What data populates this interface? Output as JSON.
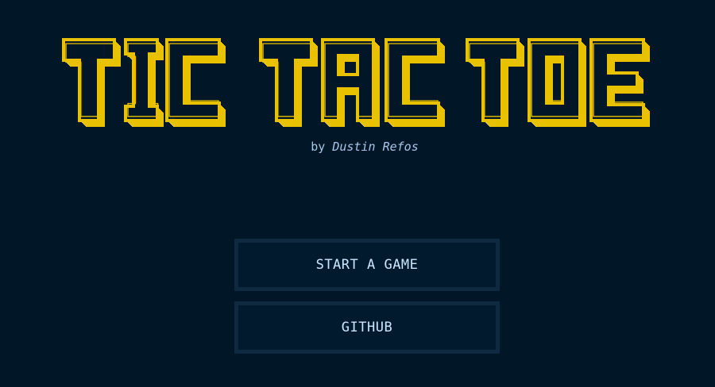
{
  "app": {
    "title": "TIC TAC TOE",
    "title_letters": [
      "T",
      "I",
      "C",
      "T",
      "A",
      "C",
      "T",
      "O",
      "E"
    ],
    "byline_prefix": "by",
    "author": "Dustin Refos"
  },
  "menu": {
    "start_label": "START A GAME",
    "github_label": "GITHUB"
  },
  "colors": {
    "background": "#011627",
    "title_face": "#e8c100",
    "title_outline": "#011627",
    "byline": "#a8c6e8",
    "button_text": "#cbe6ff",
    "button_border": "#0e2940",
    "button_fill": "#011a2e"
  }
}
